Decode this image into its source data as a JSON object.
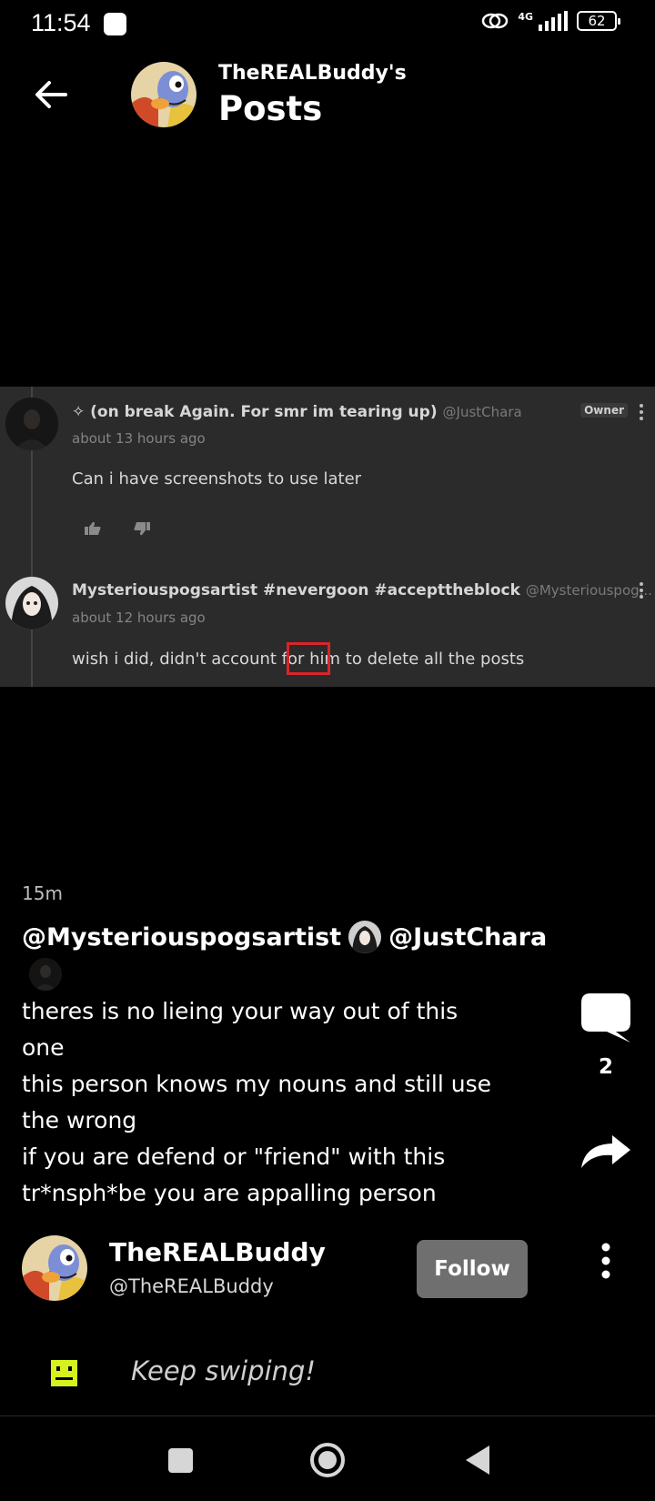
{
  "status_bar": {
    "time": "11:54",
    "network": "4G",
    "battery": "62"
  },
  "header": {
    "subtitle": "TheREALBuddy's",
    "title": "Posts"
  },
  "embedded_screenshot": {
    "comments": [
      {
        "author": "✧ (on break Again. For smr im tearing up)",
        "handle": "@JustChara",
        "time": "about 13 hours ago",
        "text": "Can i have screenshots to use later",
        "badge": "Owner"
      },
      {
        "author": "Mysteriouspogsartist #nevergoon #accepttheblock",
        "handle": "@Mysteriouspog...",
        "time": "about 12 hours ago",
        "text": "wish i did, didn't account for him to delete all the posts"
      }
    ]
  },
  "post": {
    "time": "15m",
    "mention1": "@Mysteriouspogsartist",
    "mention2": "@JustChara",
    "lines": [
      "theres is no lieing your way out of this",
      "one",
      "this person knows my nouns and still use",
      "the wrong",
      "if you are defend or \"friend\" with this",
      "tr*nsph*be you are appalling person"
    ],
    "comment_count": "2"
  },
  "author": {
    "name": "TheREALBuddy",
    "handle": "@TheREALBuddy",
    "follow_label": "Follow"
  },
  "footer": {
    "hint": "Keep swiping!"
  },
  "colors": {
    "background": "#000000",
    "follow_button": "#6f6f6f",
    "hint_icon": "#d6f11b",
    "highlight": "#d9252a"
  }
}
